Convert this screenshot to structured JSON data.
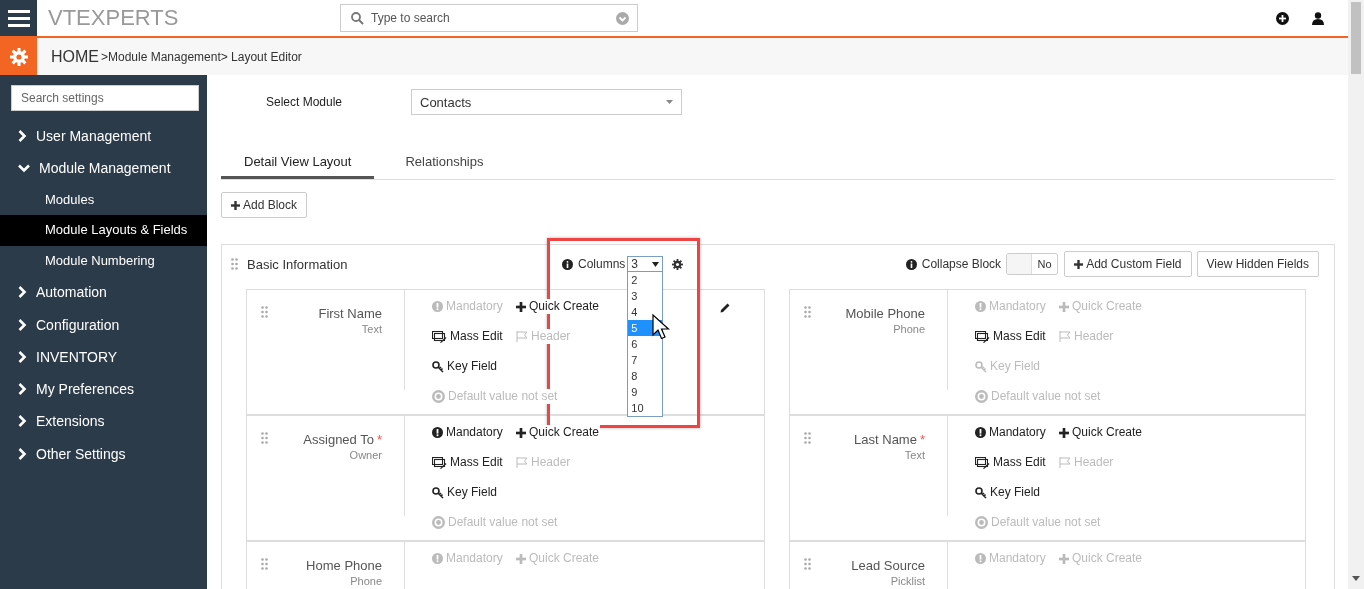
{
  "header": {
    "logo": "VTEXPERTS",
    "search": {
      "placeholder": "Type to search"
    }
  },
  "breadcrumb": {
    "home": "HOME",
    "trail": ">Module Management> Layout Editor"
  },
  "sidebar": {
    "search": {
      "placeholder": "Search settings"
    },
    "items": [
      {
        "label": "User Management",
        "expanded": false
      },
      {
        "label": "Module Management",
        "expanded": true,
        "children": [
          {
            "label": "Modules",
            "selected": false
          },
          {
            "label": "Module Layouts & Fields",
            "selected": true
          },
          {
            "label": "Module Numbering",
            "selected": false
          }
        ]
      },
      {
        "label": "Automation",
        "expanded": false
      },
      {
        "label": "Configuration",
        "expanded": false
      },
      {
        "label": "INVENTORY",
        "expanded": false
      },
      {
        "label": "My Preferences",
        "expanded": false
      },
      {
        "label": "Extensions",
        "expanded": false
      },
      {
        "label": "Other Settings",
        "expanded": false
      }
    ]
  },
  "select_module": {
    "label": "Select Module",
    "value": "Contacts"
  },
  "tabs": [
    {
      "label": "Detail View Layout",
      "selected": true
    },
    {
      "label": "Relationships",
      "selected": false
    }
  ],
  "add_block": "Add Block",
  "block": {
    "title": "Basic Information",
    "columns": {
      "label": "Columns",
      "value": "3",
      "expanded": true,
      "options": [
        {
          "label": "2",
          "highlighted": false
        },
        {
          "label": "3",
          "highlighted": false
        },
        {
          "label": "4",
          "highlighted": false
        },
        {
          "label": "5",
          "highlighted": true
        },
        {
          "label": "6",
          "highlighted": false
        },
        {
          "label": "7",
          "highlighted": false
        },
        {
          "label": "8",
          "highlighted": false
        },
        {
          "label": "9",
          "highlighted": false
        },
        {
          "label": "10",
          "highlighted": false
        }
      ]
    },
    "collapse": {
      "label": "Collapse Block",
      "on": false,
      "state_text": "No"
    },
    "add_custom_field": "Add Custom Field",
    "view_hidden_fields": "View Hidden Fields",
    "fields": [
      {
        "label": "First Name",
        "type": "Text",
        "editing": true,
        "properties": [
          {
            "kind": "mandatory",
            "label": "Mandatory",
            "on": false
          },
          {
            "kind": "quick_create",
            "label": "Quick Create",
            "on": true
          },
          {
            "kind": "mass_edit",
            "label": "Mass Edit",
            "on": true
          },
          {
            "kind": "header",
            "label": "Header",
            "on": false
          },
          {
            "kind": "key_field",
            "label": "Key Field",
            "on": true
          },
          {
            "kind": "default",
            "label": "Default value not set",
            "on": false
          }
        ]
      },
      {
        "label": "Mobile Phone",
        "type": "Phone",
        "editing": false,
        "properties": [
          {
            "kind": "mandatory",
            "label": "Mandatory",
            "on": false
          },
          {
            "kind": "quick_create",
            "label": "Quick Create",
            "on": false
          },
          {
            "kind": "mass_edit",
            "label": "Mass Edit",
            "on": true
          },
          {
            "kind": "header",
            "label": "Header",
            "on": false
          },
          {
            "kind": "key_field",
            "label": "Key Field",
            "on": false
          },
          {
            "kind": "default",
            "label": "Default value not set",
            "on": false
          }
        ]
      },
      {
        "label": "Assigned To",
        "required_mark": "*",
        "type": "Owner",
        "editing": false,
        "properties": [
          {
            "kind": "mandatory",
            "label": "Mandatory",
            "on": true
          },
          {
            "kind": "quick_create",
            "label": "Quick Create",
            "on": true
          },
          {
            "kind": "mass_edit",
            "label": "Mass Edit",
            "on": true
          },
          {
            "kind": "header",
            "label": "Header",
            "on": false
          },
          {
            "kind": "key_field",
            "label": "Key Field",
            "on": true
          },
          {
            "kind": "default",
            "label": "Default value not set",
            "on": false
          }
        ]
      },
      {
        "label": "Last Name",
        "required_mark": "*",
        "type": "Text",
        "editing": false,
        "properties": [
          {
            "kind": "mandatory",
            "label": "Mandatory",
            "on": true
          },
          {
            "kind": "quick_create",
            "label": "Quick Create",
            "on": true
          },
          {
            "kind": "mass_edit",
            "label": "Mass Edit",
            "on": true
          },
          {
            "kind": "header",
            "label": "Header",
            "on": false
          },
          {
            "kind": "key_field",
            "label": "Key Field",
            "on": true
          },
          {
            "kind": "default",
            "label": "Default value not set",
            "on": false
          }
        ]
      },
      {
        "label": "Home Phone",
        "type": "Phone",
        "editing": false,
        "properties": [
          {
            "kind": "mandatory",
            "label": "Mandatory",
            "on": false
          },
          {
            "kind": "quick_create",
            "label": "Quick Create",
            "on": false
          }
        ]
      },
      {
        "label": "Lead Source",
        "type": "Picklist",
        "editing": false,
        "properties": [
          {
            "kind": "mandatory",
            "label": "Mandatory",
            "on": false
          },
          {
            "kind": "quick_create",
            "label": "Quick Create",
            "on": false
          }
        ]
      }
    ]
  }
}
